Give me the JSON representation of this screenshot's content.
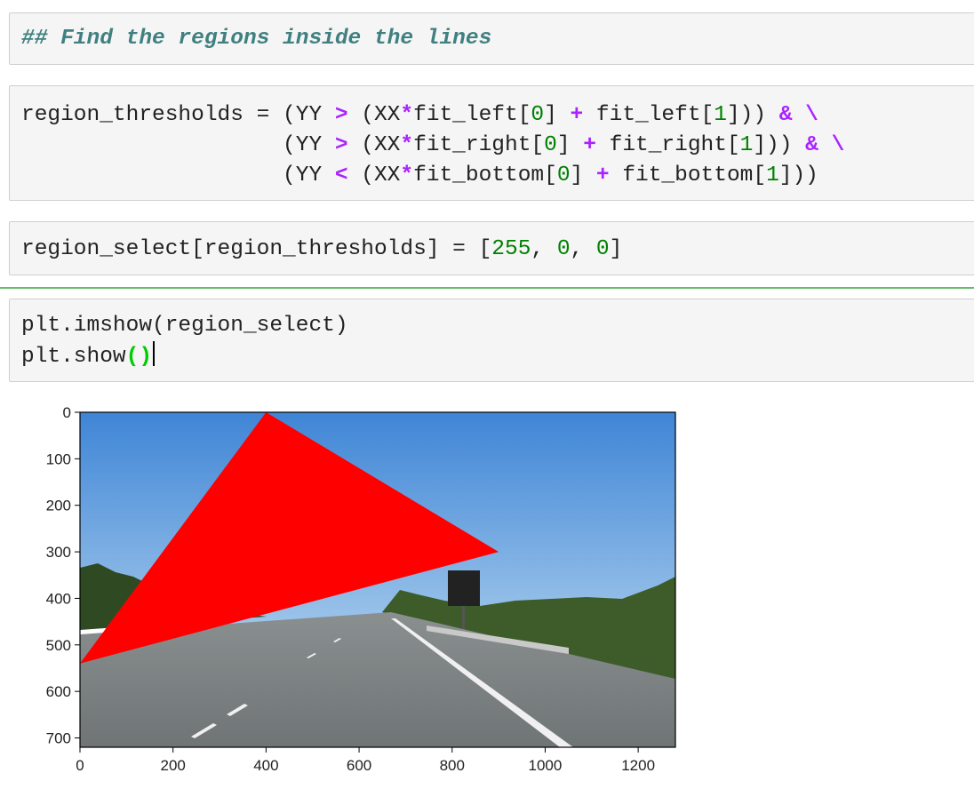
{
  "cells": [
    {
      "id": "cell1",
      "lines": [
        [
          {
            "t": "## Find the regions inside the lines",
            "c": "comment"
          }
        ]
      ]
    },
    {
      "id": "cell2",
      "lines": [
        [
          {
            "t": "region_thresholds = (YY "
          },
          {
            "t": ">",
            "c": "op"
          },
          {
            "t": " (XX"
          },
          {
            "t": "*",
            "c": "op"
          },
          {
            "t": "fit_left["
          },
          {
            "t": "0",
            "c": "num"
          },
          {
            "t": "] "
          },
          {
            "t": "+",
            "c": "op"
          },
          {
            "t": " fit_left["
          },
          {
            "t": "1",
            "c": "num"
          },
          {
            "t": "])) "
          },
          {
            "t": "&",
            "c": "op"
          },
          {
            "t": " "
          },
          {
            "t": "\\",
            "c": "op"
          }
        ],
        [
          {
            "t": "                    (YY "
          },
          {
            "t": ">",
            "c": "op"
          },
          {
            "t": " (XX"
          },
          {
            "t": "*",
            "c": "op"
          },
          {
            "t": "fit_right["
          },
          {
            "t": "0",
            "c": "num"
          },
          {
            "t": "] "
          },
          {
            "t": "+",
            "c": "op"
          },
          {
            "t": " fit_right["
          },
          {
            "t": "1",
            "c": "num"
          },
          {
            "t": "])) "
          },
          {
            "t": "&",
            "c": "op"
          },
          {
            "t": " "
          },
          {
            "t": "\\",
            "c": "op"
          }
        ],
        [
          {
            "t": "                    (YY "
          },
          {
            "t": "<",
            "c": "op"
          },
          {
            "t": " (XX"
          },
          {
            "t": "*",
            "c": "op"
          },
          {
            "t": "fit_bottom["
          },
          {
            "t": "0",
            "c": "num"
          },
          {
            "t": "] "
          },
          {
            "t": "+",
            "c": "op"
          },
          {
            "t": " fit_bottom["
          },
          {
            "t": "1",
            "c": "num"
          },
          {
            "t": "]))"
          }
        ]
      ]
    },
    {
      "id": "cell3",
      "lines": [
        [
          {
            "t": "region_select[region_thresholds] = ["
          },
          {
            "t": "255",
            "c": "num"
          },
          {
            "t": ", "
          },
          {
            "t": "0",
            "c": "num"
          },
          {
            "t": ", "
          },
          {
            "t": "0",
            "c": "num"
          },
          {
            "t": "]"
          }
        ]
      ]
    },
    {
      "id": "cell4",
      "lines": [
        [
          {
            "t": "plt.imshow(region_select)"
          }
        ],
        [
          {
            "t": "plt.show"
          },
          {
            "t": "()",
            "c": "paren-match"
          },
          {
            "t": "",
            "c": "cursor"
          }
        ]
      ]
    }
  ],
  "chart_data": {
    "type": "image",
    "xticks": [
      0,
      200,
      400,
      600,
      800,
      1000,
      1200
    ],
    "yticks": [
      0,
      100,
      200,
      300,
      400,
      500,
      600,
      700
    ],
    "xlim": [
      0,
      1280
    ],
    "ylim": [
      720,
      0
    ],
    "overlay_polygon": [
      [
        400,
        0
      ],
      [
        900,
        300
      ],
      [
        0,
        540
      ]
    ],
    "overlay_color": "#ff0000",
    "sky_color": "#5b9bd9",
    "road_color": "#7f8484"
  }
}
